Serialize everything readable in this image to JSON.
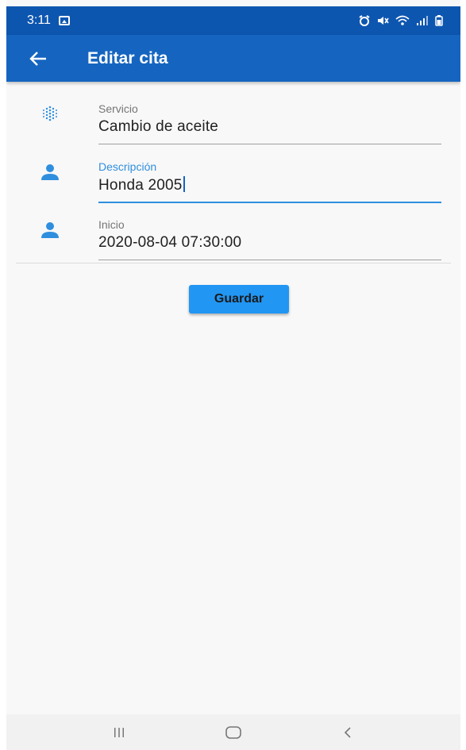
{
  "status_bar": {
    "time": "3:11",
    "icons": [
      "gallery-icon",
      "alarm-icon",
      "mute-icon",
      "wifi-icon",
      "signal-icon",
      "battery-icon"
    ]
  },
  "app_bar": {
    "title": "Editar cita",
    "back_icon": "arrow-left-icon"
  },
  "form": {
    "fields": [
      {
        "label": "Servicio",
        "value": "Cambio de aceite",
        "icon": "dots-grid-icon",
        "focused": false
      },
      {
        "label": "Descripción",
        "value": "Honda 2005",
        "icon": "person-icon",
        "focused": true
      },
      {
        "label": "Inicio",
        "value": "2020-08-04 07:30:00",
        "icon": "person-icon",
        "focused": false
      }
    ],
    "save_label": "Guardar"
  },
  "nav_bar": {
    "buttons": [
      "recents-icon",
      "home-icon",
      "back-icon"
    ]
  },
  "colors": {
    "status_bar": "#0d56b0",
    "app_bar": "#1565c0",
    "accent": "#2f8fde",
    "button": "#2196f3",
    "background": "#f8f8f8"
  }
}
